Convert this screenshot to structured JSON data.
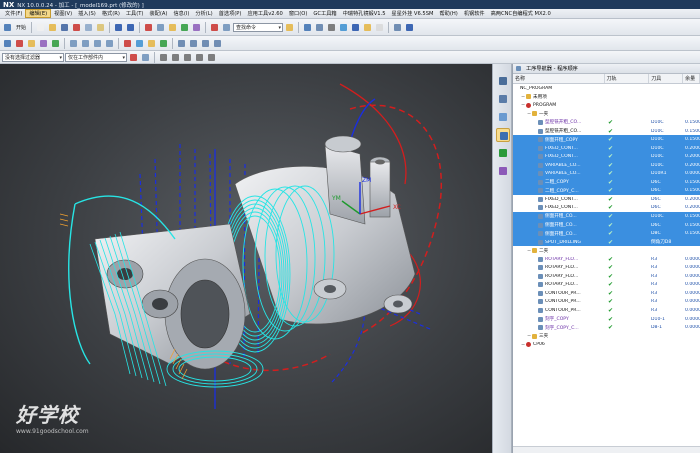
{
  "app": {
    "logo": "NX",
    "title": "NX 10.0.0.24 - 加工 - [_model169.prt  (修改的) ]"
  },
  "menu": [
    "文件(F)",
    "编辑(E)",
    "视图(V)",
    "插入(S)",
    "格式(R)",
    "工具(T)",
    "装配(A)",
    "信息(I)",
    "分析(L)",
    "首选项(P)",
    "应用工具v2.60",
    "窗口(O)",
    "GC工具箱",
    "中瑞特孔镜锻V1.5",
    "星星外挂 V6.5SM",
    "帮助(H)",
    "机钢软件",
    "高两CNC自编程式 MX2.0"
  ],
  "toolbar": {
    "start_label": "开始",
    "command_search": "查找命令",
    "selection_filter": "没有选择过滤器",
    "assembly_scope": "仅在工作部件内"
  },
  "navigator": {
    "title": "工序导航器 - 程序顺序",
    "columns": [
      "名称",
      "刀轨",
      "刀具",
      "余量"
    ]
  },
  "rows": [
    {
      "name": "NC_PROGRAM",
      "indent": 0,
      "icon": "none",
      "path": "",
      "tool": "",
      "stock": "",
      "sel": false
    },
    {
      "name": "未用项",
      "indent": 1,
      "icon": "folder",
      "path": "",
      "tool": "",
      "stock": "",
      "sel": false
    },
    {
      "name": "PROGRAM",
      "indent": 1,
      "icon": "prog",
      "path": "",
      "tool": "",
      "stock": "",
      "sel": false
    },
    {
      "name": "一夹",
      "indent": 2,
      "icon": "folder",
      "path": "",
      "tool": "",
      "stock": "",
      "sel": false
    },
    {
      "name": "型腔铣开粗_CO...",
      "indent": 3,
      "icon": "op",
      "path": "✔",
      "tool": "D10C",
      "stock": "0.1500",
      "sel": false,
      "cls": "purple"
    },
    {
      "name": "型腔铣开粗_CO...",
      "indent": 3,
      "icon": "op",
      "path": "✔",
      "tool": "D10C",
      "stock": "0.1500",
      "sel": false
    },
    {
      "name": "侧面开粗_COPY",
      "indent": 3,
      "icon": "op",
      "path": "✔",
      "tool": "D10C",
      "stock": "0.1500",
      "sel": true
    },
    {
      "name": "FIXED_CONT...",
      "indent": 3,
      "icon": "op",
      "path": "✔",
      "tool": "D10C",
      "stock": "0.2000",
      "sel": true
    },
    {
      "name": "FIXED_CONT...",
      "indent": 3,
      "icon": "op",
      "path": "✔",
      "tool": "D10C",
      "stock": "0.2000",
      "sel": true
    },
    {
      "name": "VARIABLE_CO...",
      "indent": 3,
      "icon": "op",
      "path": "✔",
      "tool": "D10C",
      "stock": "0.2000",
      "sel": true
    },
    {
      "name": "VARIABLE_CO...",
      "indent": 3,
      "icon": "op",
      "path": "✔",
      "tool": "D10R1",
      "stock": "0.0000",
      "sel": true
    },
    {
      "name": "二粗_COPY",
      "indent": 3,
      "icon": "op",
      "path": "✔",
      "tool": "D6C",
      "stock": "0.1500",
      "sel": true
    },
    {
      "name": "二粗_COPY_C...",
      "indent": 3,
      "icon": "op",
      "path": "✔",
      "tool": "D6C",
      "stock": "0.1500",
      "sel": true
    },
    {
      "name": "FIXED_CONT...",
      "indent": 3,
      "icon": "op",
      "path": "✔",
      "tool": "D6C",
      "stock": "0.2000",
      "sel": false
    },
    {
      "name": "FIXED_CONT...",
      "indent": 3,
      "icon": "op",
      "path": "✔",
      "tool": "D6C",
      "stock": "0.2000",
      "sel": false
    },
    {
      "name": "侧面开粗_CO...",
      "indent": 3,
      "icon": "op",
      "path": "✔",
      "tool": "D10C",
      "stock": "0.1500",
      "sel": true
    },
    {
      "name": "侧面开粗_CO...",
      "indent": 3,
      "icon": "op",
      "path": "✔",
      "tool": "D6C",
      "stock": "0.1500",
      "sel": true
    },
    {
      "name": "侧面开粗_CO...",
      "indent": 3,
      "icon": "op",
      "path": "✔",
      "tool": "D8C",
      "stock": "0.1500",
      "sel": true
    },
    {
      "name": "SPOT_DRILLING",
      "indent": 3,
      "icon": "op",
      "path": "✔",
      "tool": "倒角刀D8",
      "stock": "",
      "sel": true
    },
    {
      "name": "二夹",
      "indent": 2,
      "icon": "folder",
      "path": "",
      "tool": "",
      "stock": "",
      "sel": false
    },
    {
      "name": "ROTARY_FLO...",
      "indent": 3,
      "icon": "op",
      "path": "✔",
      "tool": "R3",
      "stock": "0.0000",
      "sel": false,
      "cls": "purple"
    },
    {
      "name": "ROTARY_FLO...",
      "indent": 3,
      "icon": "op",
      "path": "✔",
      "tool": "R3",
      "stock": "0.0000",
      "sel": false
    },
    {
      "name": "ROTARY_FLO...",
      "indent": 3,
      "icon": "op",
      "path": "✔",
      "tool": "R3",
      "stock": "0.0000",
      "sel": false
    },
    {
      "name": "ROTARY_FLO...",
      "indent": 3,
      "icon": "op",
      "path": "✔",
      "tool": "R3",
      "stock": "0.0000",
      "sel": false
    },
    {
      "name": "CONTOUR_PR...",
      "indent": 3,
      "icon": "op",
      "path": "✔",
      "tool": "R3",
      "stock": "0.0000",
      "sel": false
    },
    {
      "name": "CONTOUR_PR...",
      "indent": 3,
      "icon": "op",
      "path": "✔",
      "tool": "R3",
      "stock": "0.0000",
      "sel": false
    },
    {
      "name": "CONTOUR_PR...",
      "indent": 3,
      "icon": "op",
      "path": "✔",
      "tool": "R3",
      "stock": "0.0000",
      "sel": false
    },
    {
      "name": "刻字_COPY",
      "indent": 3,
      "icon": "op",
      "path": "✔",
      "tool": "D10-1",
      "stock": "0.0000",
      "sel": false,
      "cls": "purple"
    },
    {
      "name": "刻字_COPY_C...",
      "indent": 3,
      "icon": "op",
      "path": "✔",
      "tool": "D8-1",
      "stock": "0.0000",
      "sel": false,
      "cls": "purple"
    },
    {
      "name": "三夹",
      "indent": 2,
      "icon": "folder",
      "path": "",
      "tool": "",
      "stock": "",
      "sel": false
    },
    {
      "name": "CP06",
      "indent": 1,
      "icon": "prog",
      "path": "",
      "tool": "",
      "stock": "",
      "sel": false
    }
  ],
  "viewport": {
    "axis_labels": {
      "x": "XC",
      "y": "YM",
      "z": "ZM"
    },
    "watermark": "好学校",
    "watermark_url": "www.91goodschool.com"
  },
  "colors": {
    "selection": "#3b8fe0",
    "toolpath_cyan": "#27e4e4",
    "toolpath_blue": "#1a2ee0",
    "toolpath_red": "#d21e1e"
  }
}
